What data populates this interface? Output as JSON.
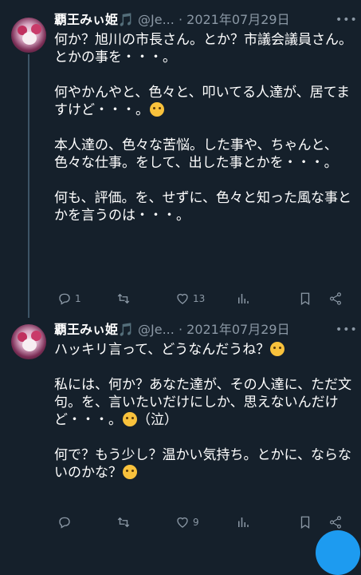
{
  "tweets": [
    {
      "name": "覇王みぃ姫",
      "name_icon": "🎵",
      "handle": "@Je...",
      "separator": "·",
      "date": "2021年07月29日",
      "more_label": "•••",
      "paragraphs": [
        "何か？旭川の市長さん。とか？市議会議員さん。とかの事を・・・。",
        "何やかんやと、色々と、叩いてる人達が、居てますけど・・・。",
        "本人達の、色々な苦悩。した事や、ちゃんと、色々な仕事。をして、出した事とかを・・・。",
        "何も、評価。を、せずに、色々と知った風な事とかを言うのは・・・。"
      ],
      "emoji_after_paragraph_2": "sweat-smile-emoji",
      "replies": "1",
      "retweets": "",
      "likes": "13",
      "views": ""
    },
    {
      "name": "覇王みぃ姫",
      "name_icon": "🎵",
      "handle": "@Je...",
      "separator": "·",
      "date": "2021年07月29日",
      "more_label": "•••",
      "paragraphs": [
        "ハッキリ言って、どうなんだうね？",
        "私には、何か？あなた達が、その人達に、ただ文句。を、言いたいだけにしか、思えないんだけど・・・。",
        "何で？もう少し？温かい気持ち。とかに、ならないのかな？"
      ],
      "paragraph_2_suffix": "（泣）",
      "replies": "",
      "retweets": "",
      "likes": "9",
      "views": ""
    }
  ],
  "colors": {
    "background": "#15202b",
    "text": "#ffffff",
    "secondary": "#8b98a5",
    "accent": "#1d9bf0"
  },
  "icons": [
    "reply-icon",
    "retweet-icon",
    "like-icon",
    "views-icon",
    "bookmark-icon",
    "share-icon"
  ]
}
